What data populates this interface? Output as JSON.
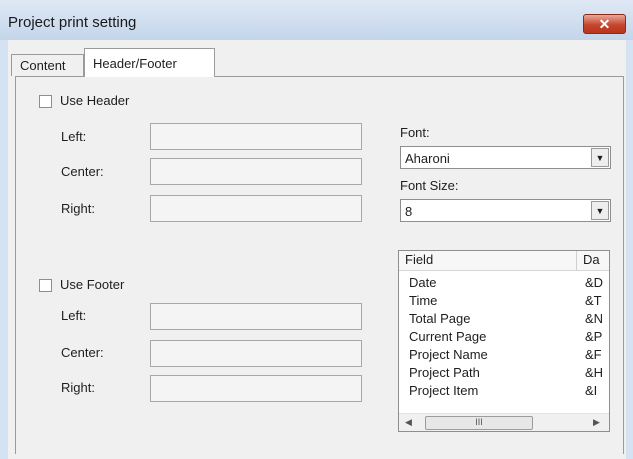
{
  "window": {
    "title": "Project print setting",
    "close_label": "✕"
  },
  "tabs": {
    "content": "Content",
    "header_footer": "Header/Footer"
  },
  "header": {
    "checkbox_label": "Use Header",
    "left_label": "Left:",
    "center_label": "Center:",
    "right_label": "Right:"
  },
  "footer": {
    "checkbox_label": "Use Footer",
    "left_label": "Left:",
    "center_label": "Center:",
    "right_label": "Right:"
  },
  "font": {
    "font_label": "Font:",
    "font_value": "Aharoni",
    "size_label": "Font Size:",
    "size_value": "8"
  },
  "field_list": {
    "columns": [
      "Field",
      "Da"
    ],
    "rows": [
      {
        "field": "Date",
        "code": "&D"
      },
      {
        "field": "Time",
        "code": "&T"
      },
      {
        "field": "Total Page",
        "code": "&N"
      },
      {
        "field": "Current Page",
        "code": "&P"
      },
      {
        "field": "Project Name",
        "code": "&F"
      },
      {
        "field": "Project Path",
        "code": "&H"
      },
      {
        "field": "Project Item",
        "code": "&I"
      }
    ],
    "scroll_thumb_glyph": "III"
  },
  "icons": {
    "dropdown": "chevron-down-icon",
    "close": "close-icon"
  }
}
